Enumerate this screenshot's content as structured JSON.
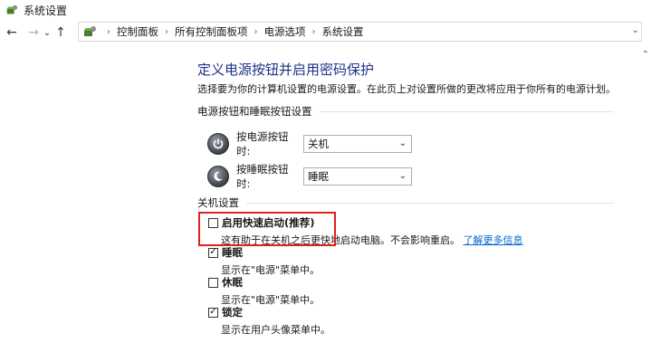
{
  "window": {
    "title": "系统设置"
  },
  "nav": {
    "back_icon": "back-arrow-icon",
    "forward_icon": "forward-arrow-icon",
    "recent_icon": "chevron-down-icon",
    "up_icon": "up-arrow-icon"
  },
  "address": {
    "breadcrumbs": [
      "控制面板",
      "所有控制面板项",
      "电源选项",
      "系统设置"
    ],
    "separator": "›"
  },
  "page": {
    "title": "定义电源按钮并启用密码保护",
    "description": "选择要为你的计算机设置的电源设置。在此页上对设置所做的更改将应用于你所有的电源计划。"
  },
  "power_section": {
    "header": "电源按钮和睡眠按钮设置",
    "rows": [
      {
        "label": "按电源按钮时:",
        "value": "关机"
      },
      {
        "label": "按睡眠按钮时:",
        "value": "睡眠"
      }
    ]
  },
  "shutdown_section": {
    "header": "关机设置",
    "items": [
      {
        "label": "启用快速启动(推荐)",
        "checked": false,
        "desc": "这有助于在关机之后更快地启动电脑。不会影响重启。",
        "link": "了解更多信息"
      },
      {
        "label": "睡眠",
        "checked": true,
        "desc": "显示在\"电源\"菜单中。"
      },
      {
        "label": "休眠",
        "checked": false,
        "desc": "显示在\"电源\"菜单中。"
      },
      {
        "label": "锁定",
        "checked": true,
        "desc": "显示在用户头像菜单中。"
      }
    ]
  },
  "colors": {
    "title": "#1e3287",
    "link": "#0066cc",
    "highlight": "#e02020"
  }
}
